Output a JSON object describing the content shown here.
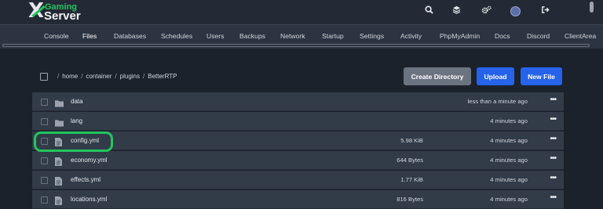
{
  "brand": {
    "gaming": "Gaming",
    "server": "Server",
    "x": "X"
  },
  "topbar_icons": [
    "search-icon",
    "layers-icon",
    "gears-icon",
    "avatar",
    "sign-out-icon"
  ],
  "nav": {
    "tabs": [
      "Console",
      "Files",
      "Databases",
      "Schedules",
      "Users",
      "Backups",
      "Network",
      "Startup",
      "Settings",
      "Activity",
      "PhpMyAdmin",
      "Docs",
      "Discord",
      "ClientArea"
    ],
    "active": "Files"
  },
  "breadcrumb": {
    "parts": [
      "home",
      "container",
      "plugins",
      "BetterRTP"
    ],
    "sep": "/"
  },
  "actions": {
    "create_directory": "Create Directory",
    "upload": "Upload",
    "new_file": "New File"
  },
  "files": [
    {
      "name": "data",
      "type": "folder",
      "size": "",
      "modified": "less than a minute ago",
      "more": "•••"
    },
    {
      "name": "lang",
      "type": "folder",
      "size": "",
      "modified": "4 minutes ago",
      "more": "•••"
    },
    {
      "name": "config.yml",
      "type": "file",
      "size": "5.98 KiB",
      "modified": "4 minutes ago",
      "more": "•••"
    },
    {
      "name": "economy.yml",
      "type": "file",
      "size": "644 Bytes",
      "modified": "4 minutes ago",
      "more": "•••"
    },
    {
      "name": "effects.yml",
      "type": "file",
      "size": "1.77 KiB",
      "modified": "4 minutes ago",
      "more": "•••"
    },
    {
      "name": "locations.yml",
      "type": "file",
      "size": "816 Bytes",
      "modified": "4 minutes ago",
      "more": "•••"
    }
  ],
  "highlighted_file": "config.yml",
  "colors": {
    "accent": "#22c55e",
    "primary": "#2563eb",
    "secondary": "#6b7280"
  }
}
